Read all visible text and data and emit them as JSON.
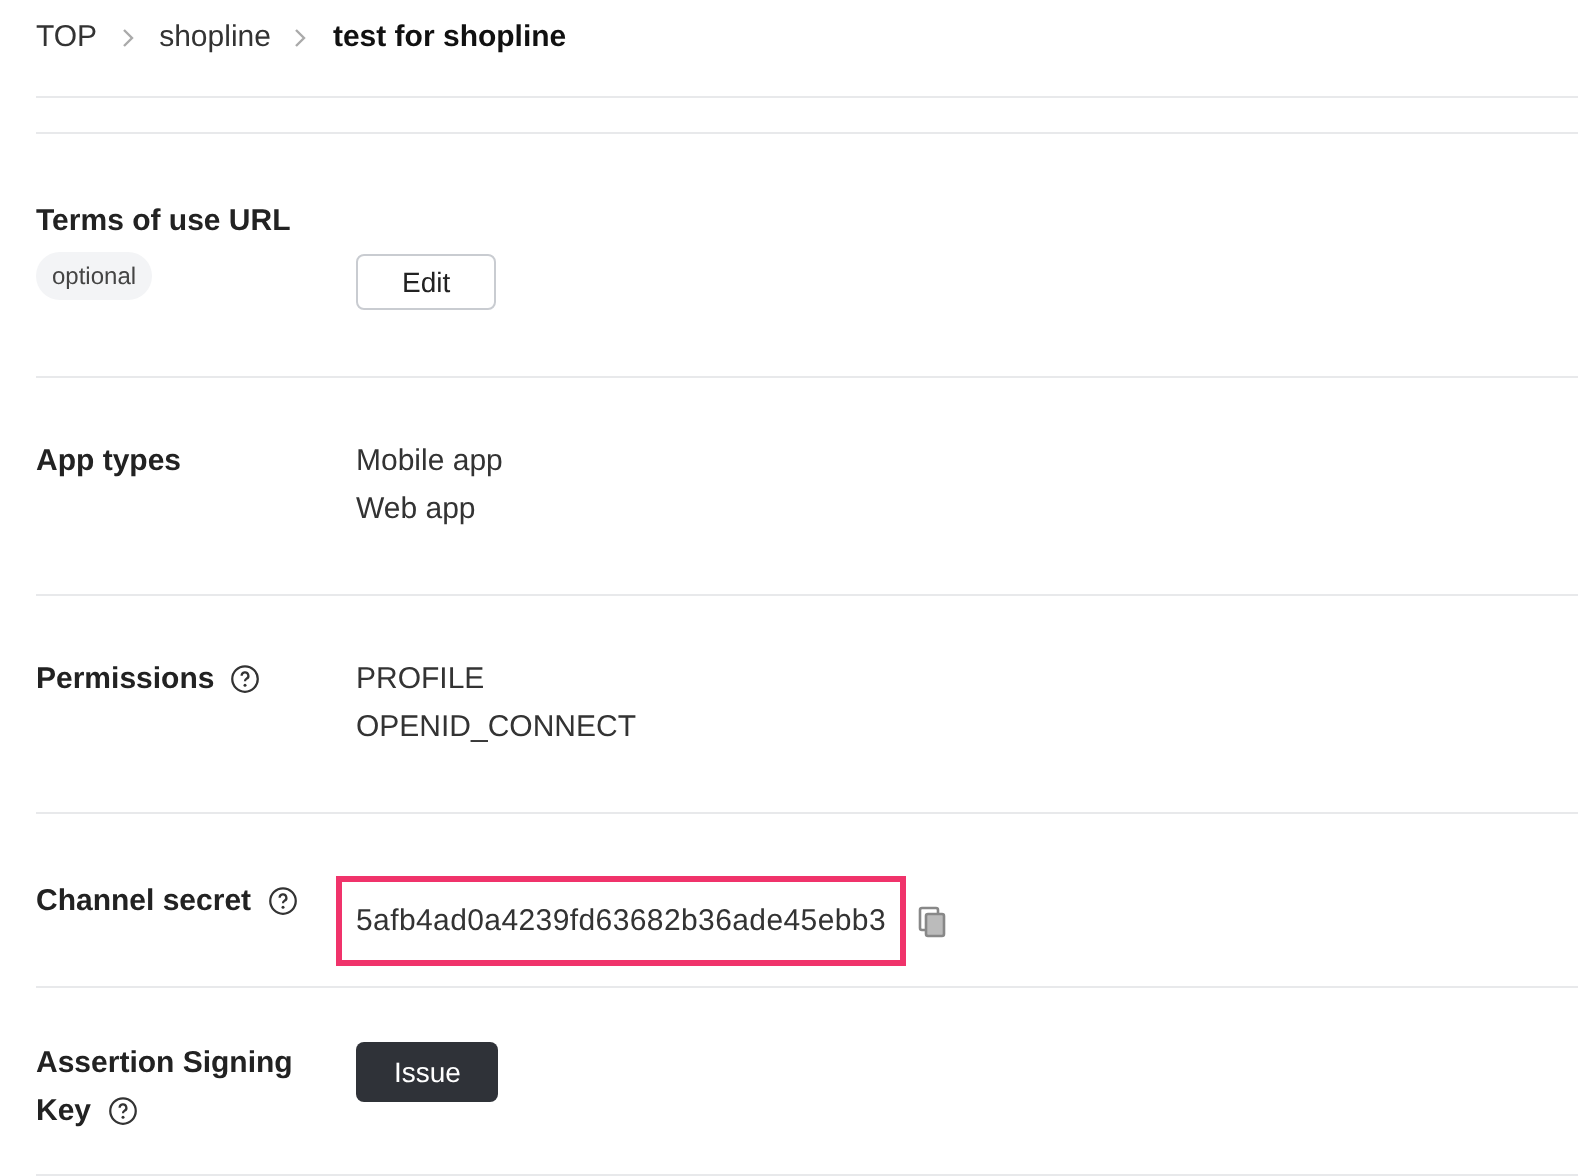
{
  "breadcrumb": [
    {
      "label": "TOP",
      "current": false
    },
    {
      "label": "shopline",
      "current": false
    },
    {
      "label": "test for shopline",
      "current": true
    }
  ],
  "rows": [
    {
      "kind": "edit",
      "label": "Terms of use URL",
      "help": false,
      "tag": "optional",
      "button": "Edit"
    },
    {
      "kind": "list",
      "label": "App types",
      "help": false,
      "values": [
        "Mobile app",
        "Web app"
      ]
    },
    {
      "kind": "list",
      "label": "Permissions",
      "help": true,
      "values": [
        "PROFILE",
        "OPENID_CONNECT"
      ]
    },
    {
      "kind": "secret",
      "label": "Channel secret",
      "help": true,
      "value": "5afb4ad0a4239fd63682b36ade45ebb3",
      "highlighted": true
    },
    {
      "kind": "issue",
      "label": "Assertion Signing Key",
      "help": true,
      "button": "Issue"
    }
  ]
}
